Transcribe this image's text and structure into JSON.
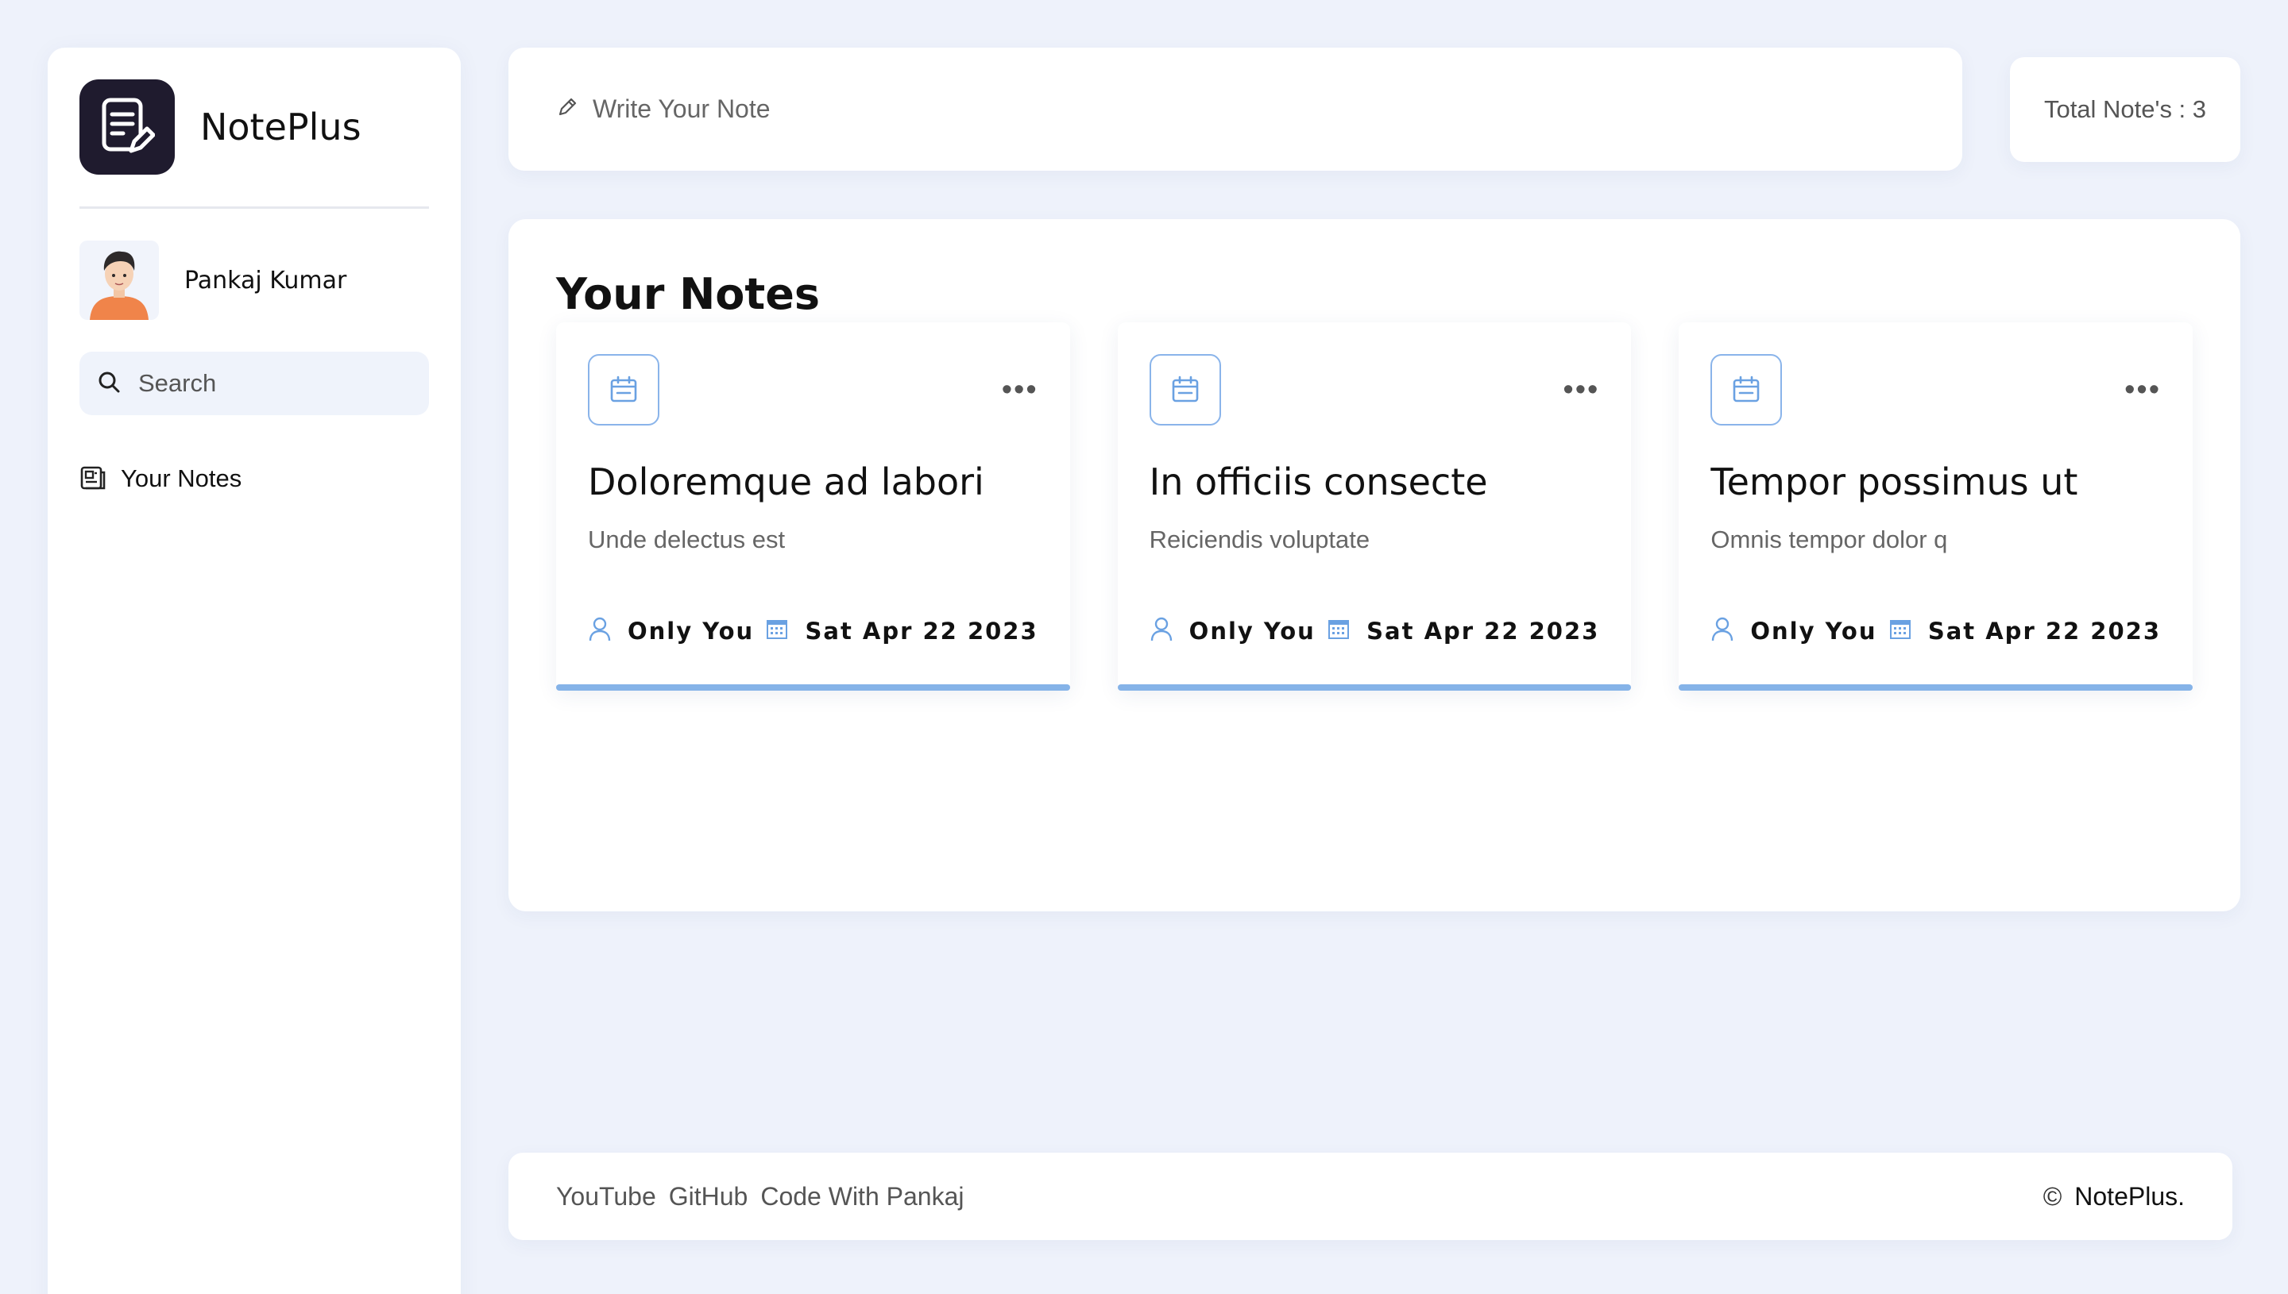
{
  "app": {
    "brand_name": "NotePlus",
    "accent_color": "#85b3e8",
    "logo_bg": "#1f1b2e"
  },
  "sidebar": {
    "user_name": "Pankaj Kumar",
    "search_label": "Search",
    "nav": [
      {
        "label": "Your Notes",
        "icon": "notes-icon"
      }
    ]
  },
  "header": {
    "write_placeholder": "Write Your Note",
    "total_label": "Total Note's : 3"
  },
  "main": {
    "title": "Your Notes",
    "notes": [
      {
        "title": "Doloremque ad labori",
        "description": "Unde delectus est",
        "visibility": "Only You",
        "date": "Sat Apr 22 2023"
      },
      {
        "title": "In officiis consecte",
        "description": "Reiciendis voluptate",
        "visibility": "Only You",
        "date": "Sat Apr 22 2023"
      },
      {
        "title": "Tempor possimus ut",
        "description": "Omnis tempor dolor q",
        "visibility": "Only You",
        "date": "Sat Apr 22 2023"
      }
    ]
  },
  "footer": {
    "links": [
      "YouTube",
      "GitHub",
      "Code With Pankaj"
    ],
    "copyright_symbol": "©",
    "copyright_text": "NotePlus."
  }
}
